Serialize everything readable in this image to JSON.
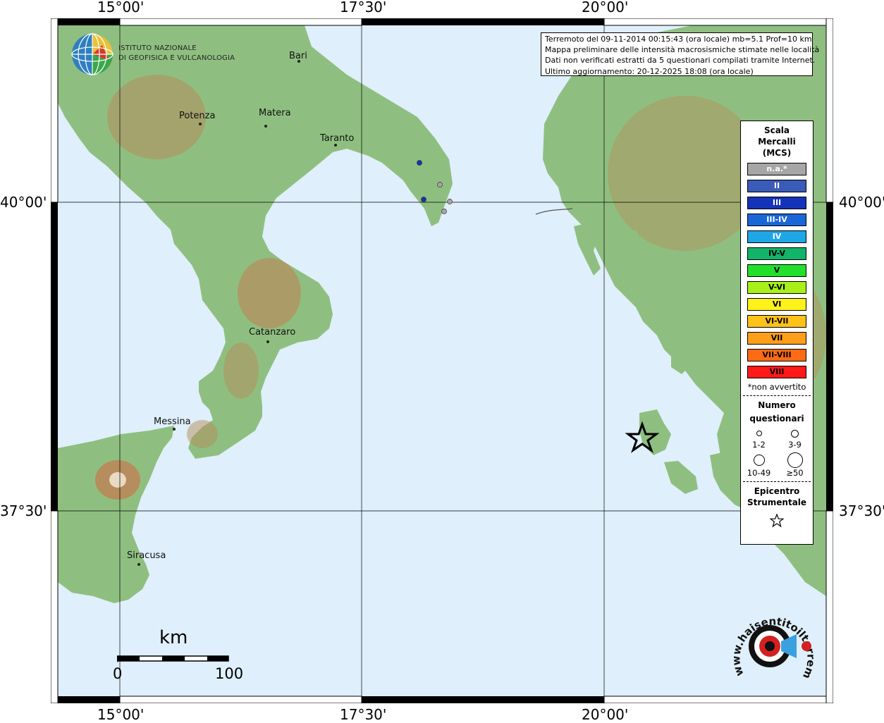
{
  "map": {
    "graticule": {
      "lon_labels": [
        "15°00'",
        "17°30'",
        "20°00'"
      ],
      "lat_labels": [
        "40°00'",
        "37°30'"
      ]
    },
    "cities": [
      "Bari",
      "Potenza",
      "Matera",
      "Taranto",
      "Catanzaro",
      "Messina",
      "Siracusa"
    ],
    "observations": [
      {
        "intensity": "III",
        "color": "#1533b8"
      },
      {
        "intensity": "III",
        "color": "#1533b8"
      },
      {
        "intensity": "n.a.*",
        "color": "#a6a6a6"
      },
      {
        "intensity": "n.a.*",
        "color": "#a6a6a6"
      },
      {
        "intensity": "n.a.*",
        "color": "#a6a6a6"
      }
    ],
    "colors": {
      "sea": "#dfeffb",
      "land": "#8fbf80",
      "highland": "#c9a26a",
      "frame": "#000000"
    }
  },
  "header": {
    "lines": [
      "Terremoto del 09-11-2014 00:15:43 (ora locale) mb=5.1 Prof=10 km",
      "Mappa preliminare delle intensità macrosismiche stimate nelle località",
      "Dati non verificati estratti da 5 questionari compilati tramite Internet.",
      "Ultimo aggiornamento: 20-12-2025 18:08 (ora locale)"
    ]
  },
  "logo": {
    "line1": "ISTITUTO NAZIONALE",
    "line2": "DI GEOFISICA E VULCANOLOGIA"
  },
  "legend": {
    "title": [
      "Scala",
      "Mercalli",
      "(MCS)"
    ],
    "levels": [
      {
        "label": "n.a.*",
        "color": "#a6a6a6",
        "text_color": "#ffffff"
      },
      {
        "label": "II",
        "color": "#3b5bb8",
        "text_color": "#ffffff"
      },
      {
        "label": "III",
        "color": "#1533b8",
        "text_color": "#ffffff"
      },
      {
        "label": "III-IV",
        "color": "#1a66d6",
        "text_color": "#ffffff"
      },
      {
        "label": "IV",
        "color": "#1fa6e6",
        "text_color": "#ffffff"
      },
      {
        "label": "IV-V",
        "color": "#13b36a",
        "text_color": "#000000"
      },
      {
        "label": "V",
        "color": "#22e02a",
        "text_color": "#000000"
      },
      {
        "label": "V-VI",
        "color": "#a8f01a",
        "text_color": "#000000"
      },
      {
        "label": "VI",
        "color": "#fff21a",
        "text_color": "#000000"
      },
      {
        "label": "VI-VII",
        "color": "#ffc21a",
        "text_color": "#000000"
      },
      {
        "label": "VII",
        "color": "#ff9e1a",
        "text_color": "#000000"
      },
      {
        "label": "VII-VIII",
        "color": "#ff6a14",
        "text_color": "#000000"
      },
      {
        "label": "VIII",
        "color": "#ff1a1a",
        "text_color": "#000000"
      }
    ],
    "note": "*non avvertito",
    "count_title": [
      "Numero",
      "questionari"
    ],
    "count_classes": [
      "1-2",
      "3-9",
      "10-49",
      "≥50"
    ],
    "epicenter_title": [
      "Epicentro",
      "Strumentale"
    ]
  },
  "scale_bar": {
    "unit": "km",
    "min": "0",
    "max": "100"
  },
  "watermark": {
    "text": "www.haisentitoilterremoto.it",
    "icon": "megaphone-icon"
  }
}
